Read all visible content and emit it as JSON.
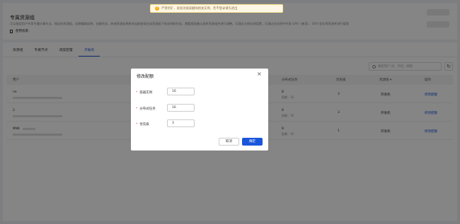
{
  "notice": {
    "icon": "warning-icon",
    "text": "严禁挖矿，发现违规或删除相关实例，若不登录请先退出"
  },
  "header": {
    "title": "专属资源组",
    "description": "可以指定用户共享专属计算节点，指定的资源组，创建编辑实例、创建任务，修改资源组将影响当前使用在该资源组下的实例和任务，需要提前确认相关资源组并进行调整。可通过左侧实例设置，可通过在实例中共享 GPU（使用）、GPU 显存等资源并进行管理",
    "doc_link": "使用指南"
  },
  "tabs": [
    "资源组",
    "专属节点",
    "调度配置",
    "子账号"
  ],
  "active_tab": 3,
  "search_placeholder": "搜索用户 ID、手机，邮箱",
  "table": {
    "columns": [
      "用户",
      "分布式任务",
      "优先级",
      "资源组",
      "操作"
    ],
    "rows": [
      {
        "user": "ne",
        "jobs": "8",
        "jobs_sub": "配额：16",
        "priority": "3",
        "group": "开发机",
        "action": "修改配额"
      },
      {
        "user": "2",
        "jobs": "8",
        "jobs_sub": "配额：16",
        "priority": "3",
        "group": "开发机",
        "action": "修改配额"
      },
      {
        "user": "NN8",
        "jobs": "8",
        "jobs_sub": "配额：16",
        "priority": "1",
        "group": "开发机",
        "action": "修改配额"
      }
    ]
  },
  "modal": {
    "title": "修改配额",
    "fields": [
      {
        "label": "容器实例",
        "value": "16"
      },
      {
        "label": "分布式任务",
        "value": "16"
      },
      {
        "label": "优先级",
        "value": "3"
      }
    ],
    "cancel": "取消",
    "ok": "确定"
  }
}
